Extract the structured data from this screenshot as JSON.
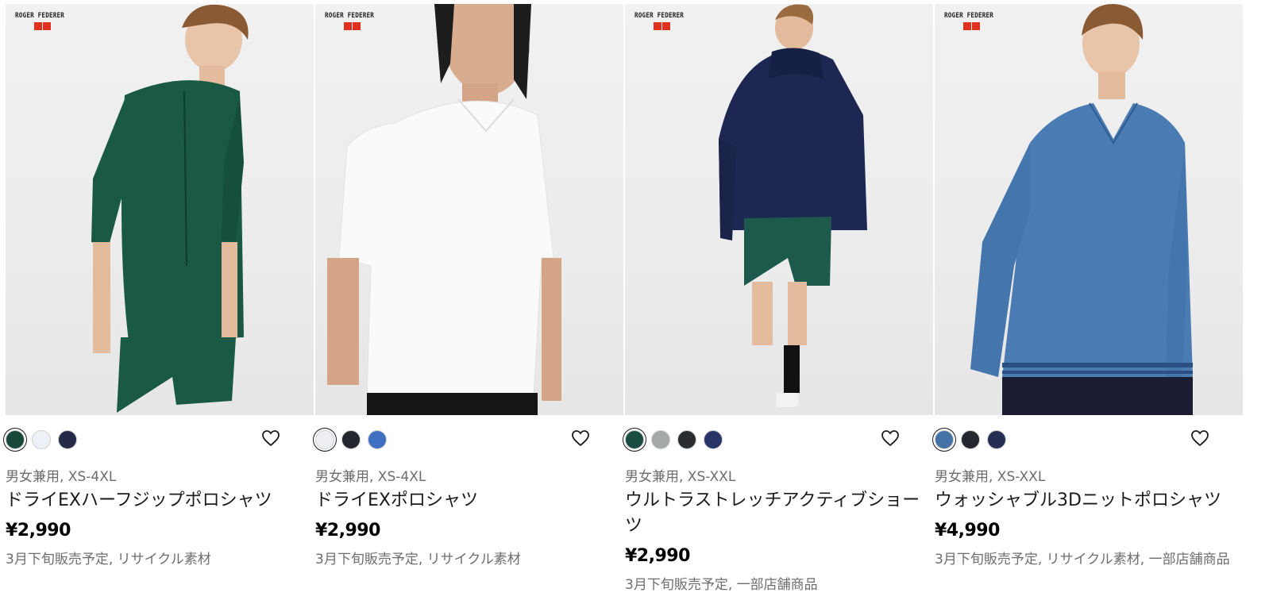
{
  "products": [
    {
      "brand_label": "ROGER FEDERER",
      "brand_logo": "ユニクロ",
      "swatches": [
        "#17483a",
        "#edf0f4",
        "#252a48"
      ],
      "selected_swatch": 0,
      "meta": "男女兼用, XS-4XL",
      "name": "ドライEXハーフジップポロシャツ",
      "price": "¥2,990",
      "note": "3月下旬販売予定, リサイクル素材",
      "garment_color": "#1a5a45",
      "bottom_color": "#1a5a45"
    },
    {
      "brand_label": "ROGER FEDERER",
      "brand_logo": "ユニクロ",
      "swatches": [
        "#eeeff2",
        "#23262c",
        "#3f6fc1"
      ],
      "selected_swatch": 0,
      "meta": "男女兼用, XS-4XL",
      "name": "ドライEXポロシャツ",
      "price": "¥2,990",
      "note": "3月下旬販売予定, リサイクル素材",
      "garment_color": "#fbfbfb",
      "bottom_color": "#151515"
    },
    {
      "brand_label": "ROGER FEDERER",
      "brand_logo": "ユニクロ",
      "swatches": [
        "#1b4c42",
        "#a6a9a8",
        "#2a2c30",
        "#283566"
      ],
      "selected_swatch": 0,
      "meta": "男女兼用, XS-XXL",
      "name": "ウルトラストレッチアクティブショーツ",
      "price": "¥2,990",
      "note": "3月下旬販売予定, 一部店舗商品",
      "garment_color": "#1d2752",
      "bottom_color": "#1e5a4c"
    },
    {
      "brand_label": "ROGER FEDERER",
      "brand_logo": "ユニクロ",
      "swatches": [
        "#4472a4",
        "#24272d",
        "#262d52"
      ],
      "selected_swatch": 0,
      "meta": "男女兼用, XS-XXL",
      "name": "ウォッシャブル3Dニットポロシャツ",
      "price": "¥4,990",
      "note": "3月下旬販売予定, リサイクル素材, 一部店舗商品",
      "garment_color": "#4a7bb3",
      "bottom_color": "#1b1d33"
    }
  ],
  "icons": {
    "favorite": "heart-outline-icon"
  }
}
